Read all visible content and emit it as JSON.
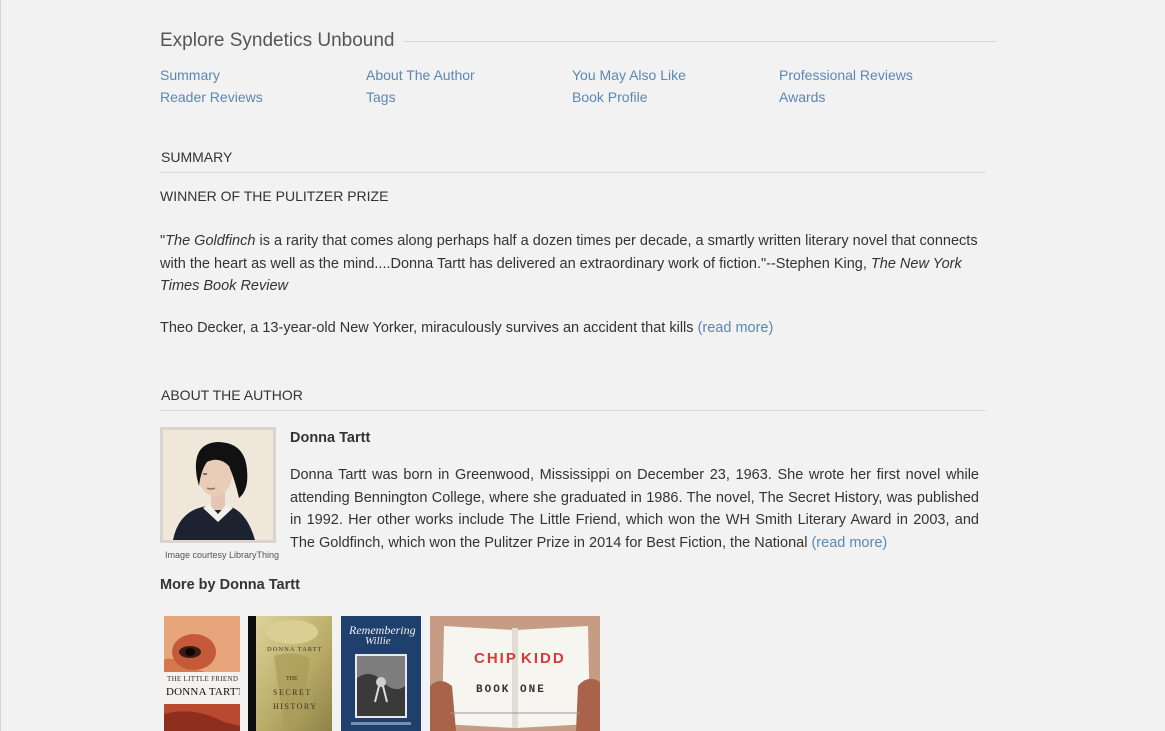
{
  "explore": {
    "title": "Explore Syndetics Unbound",
    "links": {
      "summary": "Summary",
      "about_author": "About The Author",
      "you_may_also_like": "You May Also Like",
      "professional_reviews": "Professional Reviews",
      "reader_reviews": "Reader Reviews",
      "tags": "Tags",
      "book_profile": "Book Profile",
      "awards": "Awards"
    }
  },
  "summary": {
    "heading": "SUMMARY",
    "award_line": "WINNER OF THE PULITZER PRIZE",
    "quote_open": "\"",
    "quote_title": "The Goldfinch",
    "quote_body": " is a rarity that comes along perhaps half a dozen times per decade, a smartly written literary novel that connects with the heart as well as the mind....Donna Tartt has delivered an extraordinary work of fiction.\"--Stephen King, ",
    "quote_source": "The New York Times Book Review",
    "teaser": "Theo Decker, a 13-year-old New Yorker, miraculously survives an accident that kills ",
    "read_more": "(read more)"
  },
  "about_author": {
    "heading": "ABOUT THE AUTHOR",
    "photo_credit": "Image courtesy LibraryThing",
    "name": "Donna Tartt",
    "bio": "Donna Tartt was born in Greenwood, Mississippi on December 23, 1963. She wrote her first novel while attending Bennington College, where she graduated in 1986. The novel, The Secret History, was published in 1992. Her other works include The Little Friend, which won the WH Smith Literary Award in 2003, and The Goldfinch, which won the Pulitzer Prize in 2014 for Best Fiction, the National ",
    "read_more": "(read more)"
  },
  "more_by": {
    "heading": "More by Donna Tartt",
    "books": [
      {
        "cover_line1": "THE LITTLE FRIEND",
        "cover_line2": "DONNA TARTT"
      },
      {
        "cover_line1": "DONNA TARTT",
        "cover_line2": "THE",
        "cover_line3": "SECRET",
        "cover_line4": "HISTORY"
      },
      {
        "cover_line1": "Remembering",
        "cover_line2": "Willie"
      },
      {
        "cover_line1": "CHIP",
        "cover_line2": "KIDD",
        "cover_line3": "BOOK",
        "cover_line4": "ONE"
      }
    ]
  },
  "colors": {
    "background": "#f2f2f2",
    "link": "#5b87b4",
    "text": "#333333",
    "rule": "#dcdcdc"
  }
}
